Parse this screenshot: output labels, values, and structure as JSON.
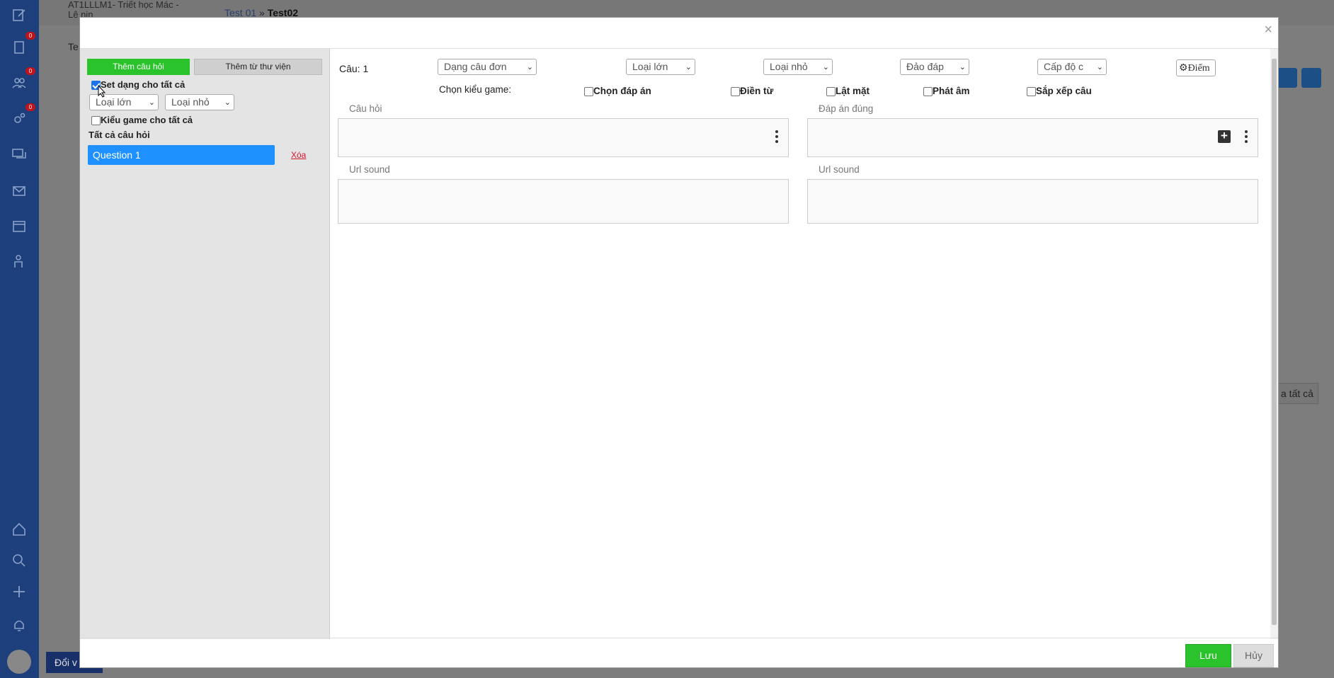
{
  "background": {
    "course_title": "AT1LLLM1- Triết học Mác - Lê nin",
    "breadcrumb": {
      "parent": "Test 01",
      "separator": "»",
      "current": "Test02"
    },
    "header_partial": "Te",
    "switch_button_partial": "Đổi v",
    "select_all_partial": "a tất cả",
    "sidebar_badges": [
      "0",
      "0",
      "0"
    ]
  },
  "modal": {
    "close_label": "×",
    "left": {
      "add_question_label": "Thêm câu hỏi",
      "add_from_library_label": "Thêm từ thư viện",
      "set_type_all_label": "Set dạng cho tất cả",
      "set_type_all_checked": true,
      "big_type_select": "Loại lớn",
      "small_type_select": "Loại nhỏ",
      "game_type_all_label": "Kiểu game cho tất cả",
      "game_type_all_checked": false,
      "all_questions_label": "Tất cả câu hỏi",
      "questions": [
        "Question 1"
      ],
      "delete_label": "Xóa"
    },
    "main": {
      "question_number_label": "Câu: 1",
      "question_type_select": "Dạng câu đơn",
      "big_type_select": "Loại lớn",
      "small_type_select": "Loại nhỏ",
      "shuffle_select": "Đảo đáp",
      "level_select": "Cấp độ c",
      "points_label": "Điểm",
      "game_type_label": "Chọn kiểu game:",
      "game_options": [
        {
          "label": "Chọn đáp án",
          "checked": false
        },
        {
          "label": "Điền từ",
          "checked": false
        },
        {
          "label": "Lật mặt",
          "checked": false
        },
        {
          "label": "Phát âm",
          "checked": false
        },
        {
          "label": "Sắp xếp câu",
          "checked": false
        }
      ],
      "question_label": "Câu hỏi",
      "correct_answer_label": "Đáp án đúng",
      "url_sound_label_left": "Url sound",
      "url_sound_label_right": "Url sound"
    },
    "footer": {
      "save_label": "Lưu",
      "cancel_label": "Hủy"
    }
  },
  "colors": {
    "sidebar": "#1d3f7c",
    "primary_green": "#2bc32b",
    "selected_blue": "#1e90ff",
    "delete_red": "#d0142d"
  }
}
